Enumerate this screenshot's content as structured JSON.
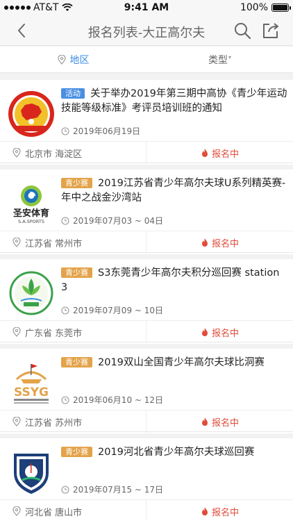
{
  "status_bar": {
    "carrier": "AT&T",
    "time": "9:41 AM",
    "battery": "100%"
  },
  "nav": {
    "title": "报名列表-大正高尔夫"
  },
  "filters": {
    "region_label": "地区",
    "type_label": "类型"
  },
  "events": [
    {
      "tag": "活动",
      "tag_color": "#4a90e2",
      "title": "关于举办2019年第三期中高协《青少年运动技能等级标准》考评员培训班的通知",
      "date": "2019年06月19日",
      "location": "北京市 海淀区",
      "status": "报名中"
    },
    {
      "tag": "青少赛",
      "tag_color": "#e3a34a",
      "title": "2019江苏省青少年高尔夫球U系列精英赛-年中之战金沙湾站",
      "date": "2019年07月03 ~ 04日",
      "location": "江苏省 常州市",
      "status": "报名中"
    },
    {
      "tag": "青少赛",
      "tag_color": "#e3a34a",
      "title": "S3东莞青少年高尔夫积分巡回赛 station 3",
      "date": "2019年07月09 ~ 10日",
      "location": "广东省 东莞市",
      "status": "报名中"
    },
    {
      "tag": "青少赛",
      "tag_color": "#e3a34a",
      "title": "2019双山全国青少年高尔夫球比洞赛",
      "date": "2019年06月10 ~ 12日",
      "location": "江苏省 苏州市",
      "status": "报名中"
    },
    {
      "tag": "青少赛",
      "tag_color": "#e3a34a",
      "title": "2019河北省青少年高尔夫球巡回赛",
      "date": "2019年07月15 ~ 17日",
      "location": "河北省 唐山市",
      "status": "报名中"
    }
  ],
  "logos": {
    "shengan_text": "圣安体育",
    "shengan_sub": "S.A.SPORTS",
    "ssyg_text": "SSYG"
  },
  "colors": {
    "accent": "#3a8ee6",
    "status": "#e04b3a",
    "tag_activity": "#4a90e2",
    "tag_youth": "#e3a34a"
  }
}
